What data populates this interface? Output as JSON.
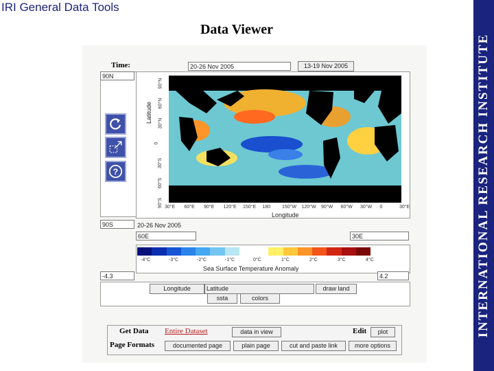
{
  "app_title": "IRI General Data Tools",
  "slide_title": "Data Viewer",
  "side_banner": "INTERNATIONAL RESEARCH INSTITUTE",
  "viewer": {
    "time_label": "Time:",
    "time_value": "20-26 Nov 2005",
    "time_button": "13-19 Nov 2005",
    "lat_top": "90N",
    "lat_bottom": "90S",
    "lon_left": "60E",
    "lon_right": "30E",
    "date_caption": "20-26 Nov 2005",
    "y_axis_label": "Latitude",
    "x_axis_label": "Longitude",
    "x_ticks": [
      "30°E",
      "60°E",
      "90°E",
      "120°E",
      "150°E",
      "180",
      "150°W",
      "120°W",
      "90°W",
      "60°W",
      "30°W",
      "0",
      "30°E"
    ],
    "y_ticks": [
      "90°N",
      "60°N",
      "30°N",
      "0",
      "30°S",
      "60°S",
      "90°S"
    ],
    "colorbar_ticks": [
      "-4°C",
      "-3°C",
      "-2°C",
      "-1°C",
      "0°C",
      "1°C",
      "2°C",
      "3°C",
      "4°C"
    ],
    "colorbar_label": "Sea Surface Temperature Anomaly",
    "colorbar_colors": [
      "#08107a",
      "#0b2fb0",
      "#1656d6",
      "#2b84ea",
      "#45a8f0",
      "#74c6f2",
      "#b8e6f4",
      "#ffffff",
      "#ffffff",
      "#fff066",
      "#ffc83a",
      "#ff9428",
      "#f2561a",
      "#d22614",
      "#a80f0f",
      "#7a0808"
    ],
    "min_value": "-4.3",
    "max_value": "4.2",
    "control_longitude": "Longitude",
    "control_latitude": "Latitude",
    "control_drawland": "draw land",
    "control_ssta": "ssta",
    "control_colors": "colors"
  },
  "nav": {
    "get_data": "Get Data",
    "entire_dataset": "Entire Dataset",
    "data_in_view": "data in view",
    "edit": "Edit",
    "plot": "plot",
    "page_formats": "Page Formats",
    "documented_page": "documented page",
    "plain_page": "plain page",
    "cut_and_paste": "cut and paste link",
    "more_options": "more options"
  }
}
